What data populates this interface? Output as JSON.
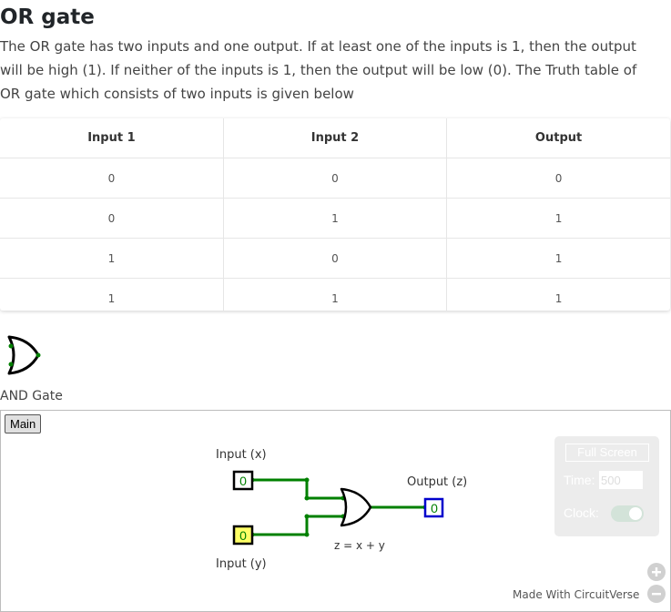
{
  "page": {
    "title": "OR gate",
    "intro": "The OR gate has two inputs and one output. If at least one of the inputs is 1, then the output will be high (1). If neither of the inputs is 1, then the output will be low (0). The Truth table of OR gate which consists of two inputs is given below"
  },
  "truth_table": {
    "headers": [
      "Input 1",
      "Input 2",
      "Output"
    ],
    "rows": [
      [
        "0",
        "0",
        "0"
      ],
      [
        "0",
        "1",
        "1"
      ],
      [
        "1",
        "0",
        "1"
      ],
      [
        "1",
        "1",
        "1"
      ]
    ]
  },
  "gate_preview": {
    "label": "AND Gate",
    "icon": "or-gate-icon"
  },
  "simulator": {
    "tab_label": "Main",
    "circuit": {
      "input_x_label": "Input (x)",
      "input_y_label": "Input (y)",
      "output_label": "Output (z)",
      "input_x_value": "0",
      "input_y_value": "0",
      "output_value": "0",
      "expression": "z = x + y"
    },
    "controls": {
      "fullscreen_label": "Full Screen",
      "time_label": "Time:",
      "time_value": "500",
      "clock_label": "Clock:",
      "clock_on": true
    },
    "made_with": "Made With CircuitVerse",
    "zoom_in_icon": "zoom-in-icon",
    "zoom_out_icon": "zoom-out-icon"
  },
  "colors": {
    "wire": "#008000",
    "input_y_fill": "#ffff66",
    "output_border": "#0000cc"
  }
}
